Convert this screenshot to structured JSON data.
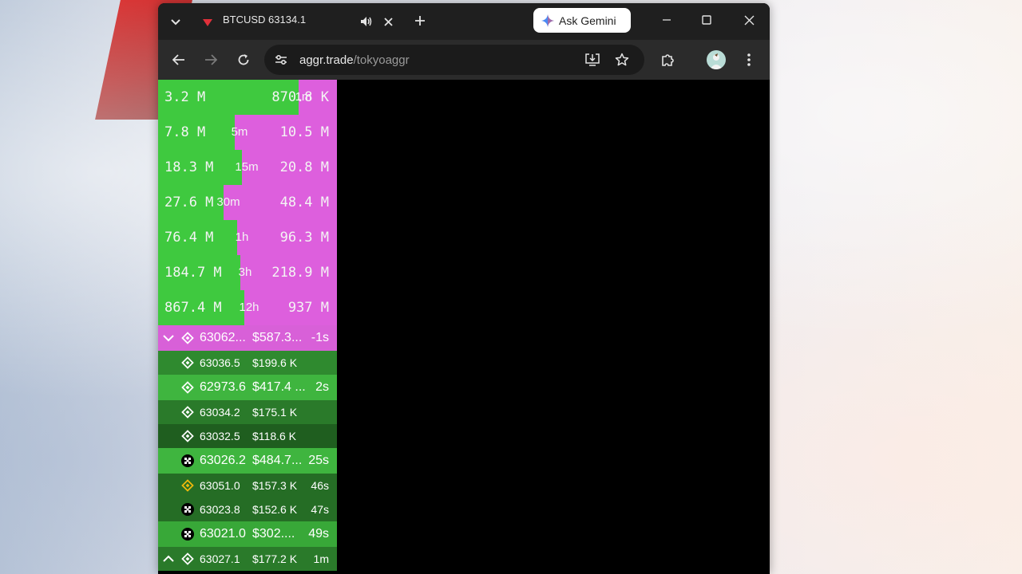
{
  "browser": {
    "tab_title": "BTCUSD 63134.1",
    "ask_gemini": "Ask Gemini",
    "url_host": "aggr.trade",
    "url_path": "/tokyoaggr",
    "colors": {
      "tabbar": "#1f1f1f",
      "toolbar": "#2b2b2b",
      "omnibox": "#1b1b1b"
    }
  },
  "stats": {
    "colors": {
      "buy": "#3fc93f",
      "sell": "#dd5fdd"
    },
    "rows": [
      {
        "buy": "3.2 M",
        "interval": "1m",
        "sell": "870.8 K",
        "buy_share": 0.785
      },
      {
        "buy": "7.8 M",
        "interval": "5m",
        "sell": "10.5 M",
        "buy_share": 0.43
      },
      {
        "buy": "18.3 M",
        "interval": "15m",
        "sell": "20.8 M",
        "buy_share": 0.47
      },
      {
        "buy": "27.6 M",
        "interval": "30m",
        "sell": "48.4 M",
        "buy_share": 0.365
      },
      {
        "buy": "76.4 M",
        "interval": "1h",
        "sell": "96.3 M",
        "buy_share": 0.44
      },
      {
        "buy": "184.7 M",
        "interval": "3h",
        "sell": "218.9 M",
        "buy_share": 0.46
      },
      {
        "buy": "867.4 M",
        "interval": "12h",
        "sell": "937 M",
        "buy_share": 0.48
      }
    ]
  },
  "trades": [
    {
      "arrow": "down",
      "exchange": "binance",
      "price": "63062...",
      "amount": "$587.3...",
      "age": "-1s",
      "side": "sell",
      "size": "large",
      "bg": "#d860d8"
    },
    {
      "arrow": "",
      "exchange": "binance",
      "price": "63036.5",
      "amount": "$199.6 K",
      "age": "",
      "side": "buy",
      "size": "small",
      "bg": "#2f8a2f"
    },
    {
      "arrow": "",
      "exchange": "binance",
      "price": "62973.6",
      "amount": "$417.4 ...",
      "age": "2s",
      "side": "buy",
      "size": "large",
      "bg": "#3fb53f"
    },
    {
      "arrow": "",
      "exchange": "binance",
      "price": "63034.2",
      "amount": "$175.1 K",
      "age": "",
      "side": "buy",
      "size": "small",
      "bg": "#2a7a2a"
    },
    {
      "arrow": "",
      "exchange": "binance",
      "price": "63032.5",
      "amount": "$118.6 K",
      "age": "",
      "side": "buy",
      "size": "small",
      "bg": "#1f5e1f"
    },
    {
      "arrow": "",
      "exchange": "okx",
      "price": "63026.2",
      "amount": "$484.7...",
      "age": "25s",
      "side": "buy",
      "size": "large",
      "bg": "#3fb53f"
    },
    {
      "arrow": "",
      "exchange": "binance-gold",
      "price": "63051.0",
      "amount": "$157.3 K",
      "age": "46s",
      "side": "buy",
      "size": "small",
      "bg": "#256d25"
    },
    {
      "arrow": "",
      "exchange": "okx",
      "price": "63023.8",
      "amount": "$152.6 K",
      "age": "47s",
      "side": "buy",
      "size": "small",
      "bg": "#256d25"
    },
    {
      "arrow": "",
      "exchange": "okx",
      "price": "63021.0",
      "amount": "$302....",
      "age": "49s",
      "side": "buy",
      "size": "large",
      "bg": "#38a838"
    },
    {
      "arrow": "up",
      "exchange": "binance",
      "price": "63027.1",
      "amount": "$177.2 K",
      "age": "1m",
      "side": "buy",
      "size": "small",
      "bg": "#2a7a2a"
    }
  ]
}
